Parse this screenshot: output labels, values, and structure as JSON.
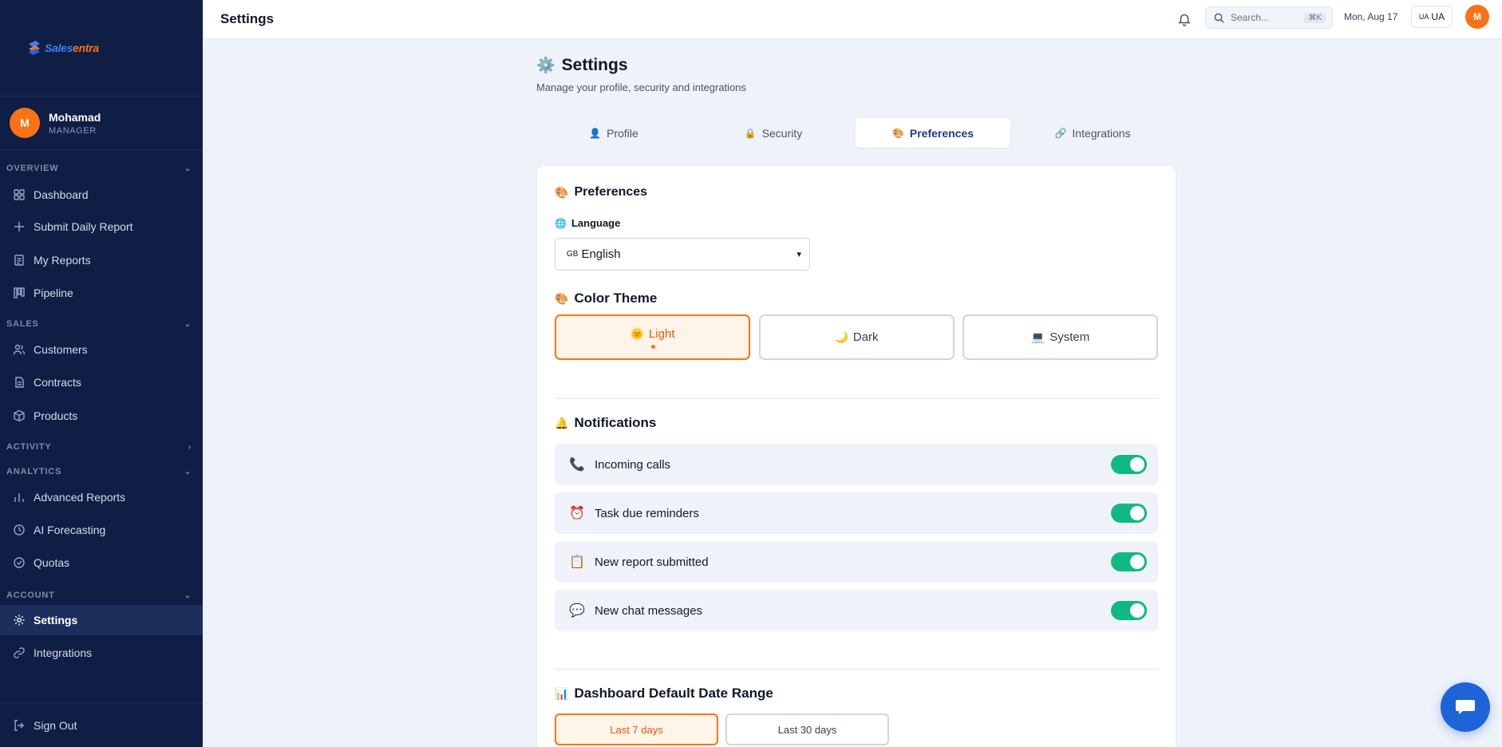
{
  "brand": {
    "name_part1": "Sales",
    "name_part2": "entra"
  },
  "user": {
    "initial": "M",
    "name": "Mohamad",
    "role": "MANAGER"
  },
  "sidebar": {
    "sections": [
      {
        "label": "OVERVIEW"
      },
      {
        "label": "SALES"
      },
      {
        "label": "ACTIVITY"
      },
      {
        "label": "ANALYTICS"
      },
      {
        "label": "ACCOUNT"
      }
    ],
    "items": [
      {
        "label": "Dashboard",
        "icon": "grid-icon"
      },
      {
        "label": "Submit Daily Report",
        "icon": "plus-icon"
      },
      {
        "label": "My Reports",
        "icon": "document-icon"
      },
      {
        "label": "Pipeline",
        "icon": "kanban-icon"
      },
      {
        "label": "Customers",
        "icon": "users-icon"
      },
      {
        "label": "Contracts",
        "icon": "file-icon"
      },
      {
        "label": "Products",
        "icon": "box-icon"
      },
      {
        "label": "Advanced Reports",
        "icon": "bar-chart-icon"
      },
      {
        "label": "AI Forecasting",
        "icon": "clock-icon"
      },
      {
        "label": "Quotas",
        "icon": "check-circle-icon"
      },
      {
        "label": "Settings",
        "icon": "gear-icon"
      },
      {
        "label": "Integrations",
        "icon": "link-icon"
      }
    ],
    "signout": "Sign Out"
  },
  "topbar": {
    "title": "Settings",
    "search_placeholder": "Search...",
    "search_shortcut": "⌘K",
    "date": "Mon, Aug 17",
    "lang_flag": "UA",
    "lang_code": "UA",
    "avatar_initial": "M"
  },
  "page": {
    "title": "Settings",
    "subtitle": "Manage your profile, security and integrations"
  },
  "tabs": [
    {
      "label": "Profile",
      "emoji": "👤"
    },
    {
      "label": "Security",
      "emoji": "🔒"
    },
    {
      "label": "Preferences",
      "emoji": "🎨"
    },
    {
      "label": "Integrations",
      "emoji": "🔗"
    }
  ],
  "preferences": {
    "heading": "Preferences",
    "language_label": "Language",
    "language_flag": "GB",
    "language_value": "English",
    "theme_heading": "Color Theme",
    "themes": [
      {
        "label": "Light",
        "emoji": "🌞"
      },
      {
        "label": "Dark",
        "emoji": "🌙"
      },
      {
        "label": "System",
        "emoji": "💻"
      }
    ],
    "notifications_heading": "Notifications",
    "notifications": [
      {
        "label": "Incoming calls",
        "emoji": "📞",
        "enabled": true
      },
      {
        "label": "Task due reminders",
        "emoji": "⏰",
        "enabled": true
      },
      {
        "label": "New report submitted",
        "emoji": "📋",
        "enabled": true
      },
      {
        "label": "New chat messages",
        "emoji": "💬",
        "enabled": true
      }
    ],
    "date_range_heading": "Dashboard Default Date Range",
    "date_ranges": [
      {
        "label": "Last 7 days"
      },
      {
        "label": "Last 30 days"
      }
    ]
  },
  "colors": {
    "accent": "#f97316",
    "sidebar": "#0f1e45",
    "toggle_on": "#10b981",
    "chat_fab": "#1d64d8"
  }
}
